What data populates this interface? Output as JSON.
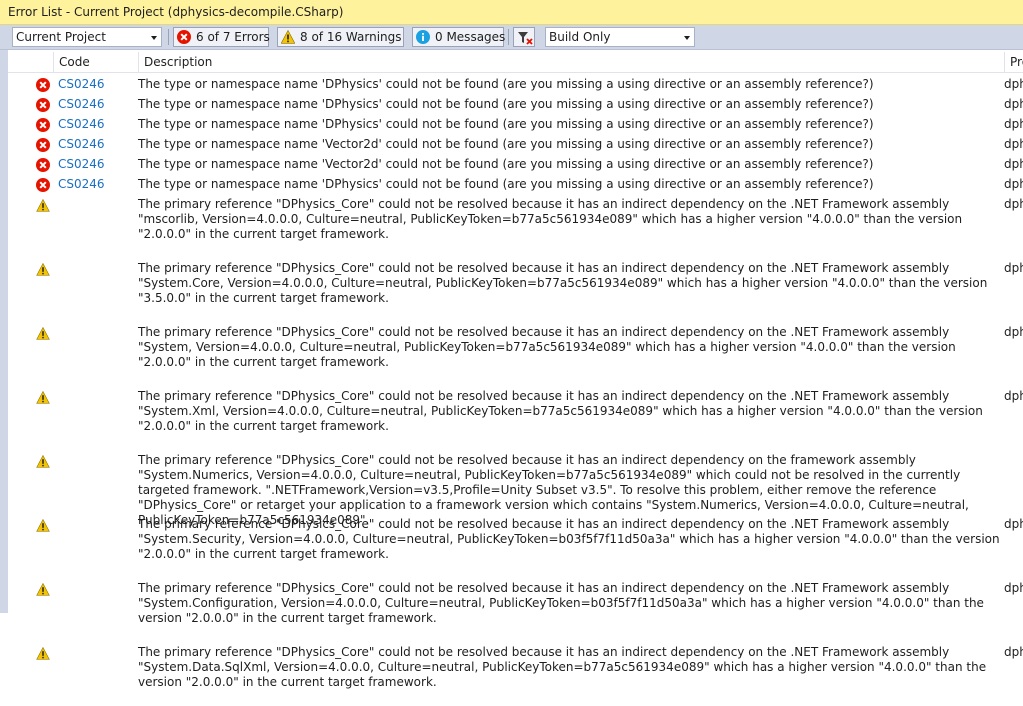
{
  "window": {
    "title": "Error List - Current Project (dphysics-decompile.CSharp)"
  },
  "toolbar": {
    "scope_value": "Current Project",
    "errors_label": "6 of 7 Errors",
    "warnings_label": "8 of 16 Warnings",
    "messages_label": "0 Messages",
    "build_value": "Build Only"
  },
  "columns": {
    "code": "Code",
    "description": "Description",
    "project": "Pro"
  },
  "colors": {
    "error": "#e51400",
    "warning": "#f5c400",
    "info": "#1ba1e2",
    "link": "#1a6fc0"
  },
  "rows": [
    {
      "type": "error",
      "code": "CS0246",
      "description": "The type or namespace name 'DPhysics' could not be found (are you missing a using directive or an assembly reference?)",
      "project": "dph"
    },
    {
      "type": "error",
      "code": "CS0246",
      "description": "The type or namespace name 'DPhysics' could not be found (are you missing a using directive or an assembly reference?)",
      "project": "dph"
    },
    {
      "type": "error",
      "code": "CS0246",
      "description": "The type or namespace name 'DPhysics' could not be found (are you missing a using directive or an assembly reference?)",
      "project": "dph"
    },
    {
      "type": "error",
      "code": "CS0246",
      "description": "The type or namespace name 'Vector2d' could not be found (are you missing a using directive or an assembly reference?)",
      "project": "dph"
    },
    {
      "type": "error",
      "code": "CS0246",
      "description": "The type or namespace name 'Vector2d' could not be found (are you missing a using directive or an assembly reference?)",
      "project": "dph"
    },
    {
      "type": "error",
      "code": "CS0246",
      "description": "The type or namespace name 'DPhysics' could not be found (are you missing a using directive or an assembly reference?)",
      "project": "dph"
    },
    {
      "type": "warning",
      "code": "",
      "description": "The primary reference \"DPhysics_Core\" could not be resolved because it has an indirect dependency on the .NET Framework assembly \"mscorlib, Version=4.0.0.0, Culture=neutral, PublicKeyToken=b77a5c561934e089\" which has a higher version \"4.0.0.0\" than the version \"2.0.0.0\" in the current target framework.",
      "project": "dph"
    },
    {
      "type": "warning",
      "code": "",
      "description": "The primary reference \"DPhysics_Core\" could not be resolved because it has an indirect dependency on the .NET Framework assembly \"System.Core, Version=4.0.0.0, Culture=neutral, PublicKeyToken=b77a5c561934e089\" which has a higher version \"4.0.0.0\" than the version \"3.5.0.0\" in the current target framework.",
      "project": "dph"
    },
    {
      "type": "warning",
      "code": "",
      "description": "The primary reference \"DPhysics_Core\" could not be resolved because it has an indirect dependency on the .NET Framework assembly \"System, Version=4.0.0.0, Culture=neutral, PublicKeyToken=b77a5c561934e089\" which has a higher version \"4.0.0.0\" than the version \"2.0.0.0\" in the current target framework.",
      "project": "dph"
    },
    {
      "type": "warning",
      "code": "",
      "description": "The primary reference \"DPhysics_Core\" could not be resolved because it has an indirect dependency on the .NET Framework assembly \"System.Xml, Version=4.0.0.0, Culture=neutral, PublicKeyToken=b77a5c561934e089\" which has a higher version \"4.0.0.0\" than the version \"2.0.0.0\" in the current target framework.",
      "project": "dph"
    },
    {
      "type": "warning",
      "code": "",
      "description": "The primary reference \"DPhysics_Core\" could not be resolved because it has an indirect dependency on the framework assembly \"System.Numerics, Version=4.0.0.0, Culture=neutral, PublicKeyToken=b77a5c561934e089\" which could not be resolved in the currently targeted framework. \".NETFramework,Version=v3.5,Profile=Unity Subset v3.5\". To resolve this problem, either remove the reference \"DPhysics_Core\" or retarget your application to a framework version which contains \"System.Numerics, Version=4.0.0.0, Culture=neutral, PublicKeyToken=b77a5c561934e089\".",
      "project": ""
    },
    {
      "type": "warning",
      "code": "",
      "description": "The primary reference \"DPhysics_Core\" could not be resolved because it has an indirect dependency on the .NET Framework assembly \"System.Security, Version=4.0.0.0, Culture=neutral, PublicKeyToken=b03f5f7f11d50a3a\" which has a higher version \"4.0.0.0\" than the version \"2.0.0.0\" in the current target framework.",
      "project": "dph"
    },
    {
      "type": "warning",
      "code": "",
      "description": "The primary reference \"DPhysics_Core\" could not be resolved because it has an indirect dependency on the .NET Framework assembly \"System.Configuration, Version=4.0.0.0, Culture=neutral, PublicKeyToken=b03f5f7f11d50a3a\" which has a higher version \"4.0.0.0\" than the version \"2.0.0.0\" in the current target framework.",
      "project": "dph"
    },
    {
      "type": "warning",
      "code": "",
      "description": "The primary reference \"DPhysics_Core\" could not be resolved because it has an indirect dependency on the .NET Framework assembly \"System.Data.SqlXml, Version=4.0.0.0, Culture=neutral, PublicKeyToken=b77a5c561934e089\" which has a higher version \"4.0.0.0\" than the version \"2.0.0.0\" in the current target framework.",
      "project": "dph"
    }
  ]
}
